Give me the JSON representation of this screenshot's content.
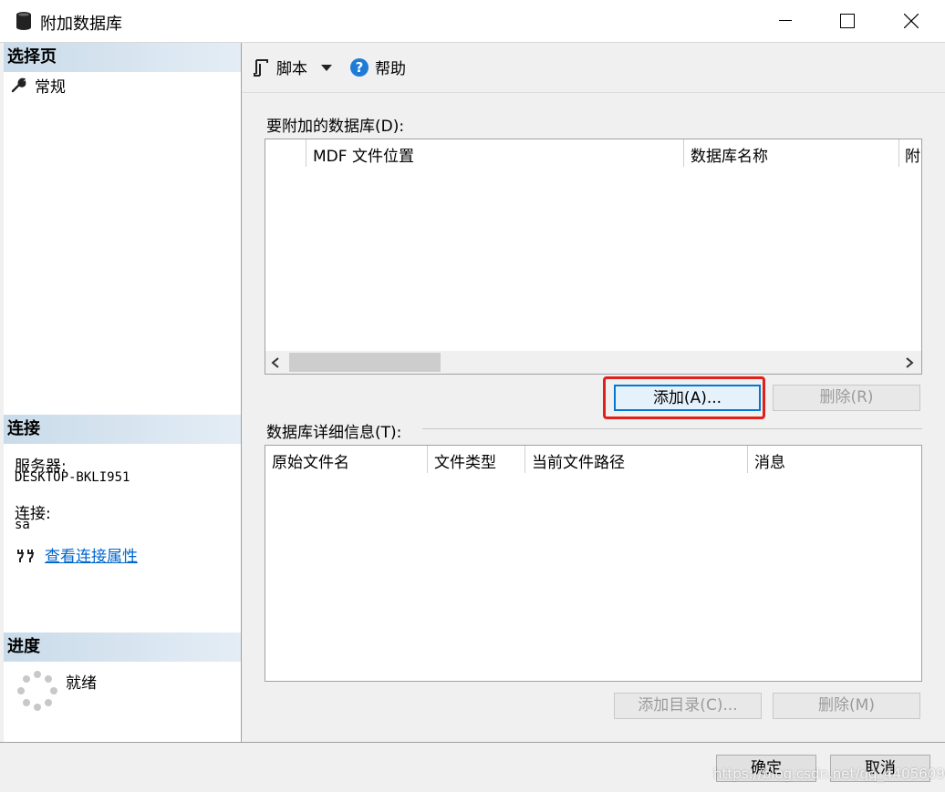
{
  "window": {
    "title": "附加数据库"
  },
  "sidebar": {
    "select_page_header": "选择页",
    "items": [
      {
        "label": "常规"
      }
    ],
    "connection_header": "连接",
    "server_label": "服务器:",
    "server_value": "DESKTOP-BKLI951",
    "connection_label": "连接:",
    "connection_value": "sa",
    "view_properties_link": "查看连接属性",
    "progress_header": "进度",
    "progress_status": "就绪"
  },
  "toolbar": {
    "script_label": "脚本",
    "help_label": "帮助"
  },
  "attach_section": {
    "label": "要附加的数据库(D):",
    "columns": [
      "MDF 文件位置",
      "数据库名称",
      "附"
    ],
    "add_button": "添加(A)...",
    "remove_button": "删除(R)"
  },
  "details_section": {
    "label": "数据库详细信息(T):",
    "columns": [
      "原始文件名",
      "文件类型",
      "当前文件路径",
      "消息"
    ],
    "add_catalog_button": "添加目录(C)...",
    "remove_button": "删除(M)"
  },
  "footer": {
    "ok_button": "确定",
    "cancel_button": "取消"
  },
  "watermark": "https://blog.csdn.net/qq_44056090",
  "colors": {
    "highlight_box": "#e0201a",
    "link": "#0066cc",
    "header_bg": "#c9dbea"
  }
}
